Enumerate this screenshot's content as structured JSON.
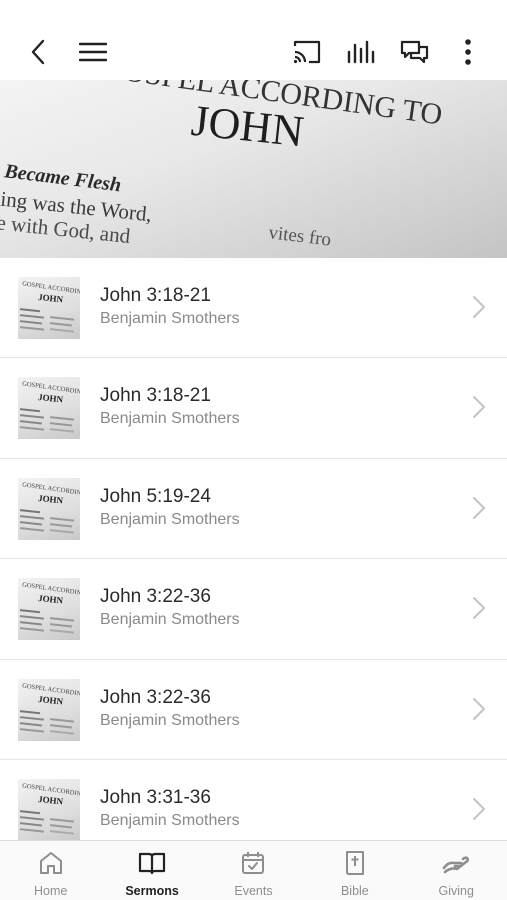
{
  "toolbar": {
    "icons": [
      "back-icon",
      "menu-icon",
      "cast-icon",
      "audio-bars-icon",
      "chat-icon",
      "more-icon"
    ]
  },
  "hero": {
    "line1": "GOSPEL ACCORDING TO",
    "line2": "JOHN",
    "line3": "Became Flesh",
    "line4": "ing was the Word,",
    "line5": "e with God, and",
    "line6": "vites fro"
  },
  "sermons": [
    {
      "title": "John 3:18-21",
      "speaker": "Benjamin Smothers"
    },
    {
      "title": "John 3:18-21",
      "speaker": "Benjamin Smothers"
    },
    {
      "title": "John 5:19-24",
      "speaker": "Benjamin Smothers"
    },
    {
      "title": "John 3:22-36",
      "speaker": "Benjamin Smothers"
    },
    {
      "title": "John 3:22-36",
      "speaker": "Benjamin Smothers"
    },
    {
      "title": "John 3:31-36",
      "speaker": "Benjamin Smothers"
    }
  ],
  "tabs": [
    {
      "label": "Home",
      "icon": "home-icon",
      "active": false
    },
    {
      "label": "Sermons",
      "icon": "book-icon",
      "active": true
    },
    {
      "label": "Events",
      "icon": "calendar-icon",
      "active": false
    },
    {
      "label": "Bible",
      "icon": "bible-icon",
      "active": false
    },
    {
      "label": "Giving",
      "icon": "giving-icon",
      "active": false
    }
  ],
  "colors": {
    "active_tab": "#222222",
    "inactive_tab": "#8e8e8e",
    "subtitle": "#8a8a8a"
  }
}
